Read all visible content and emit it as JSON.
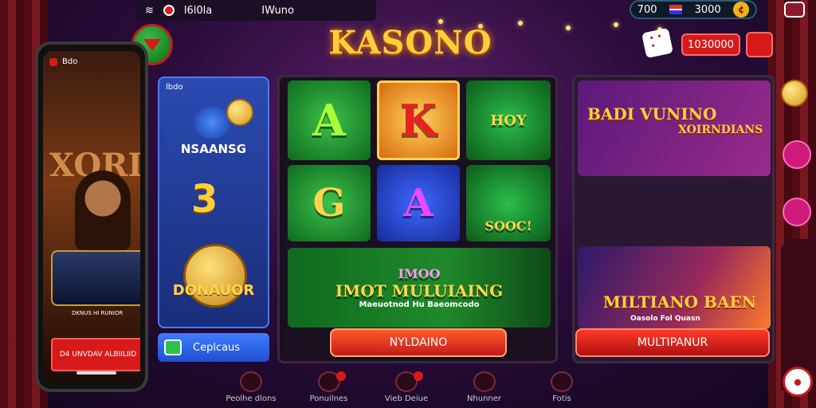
{
  "statusbar": {
    "left_text": "l6l0la",
    "right_text": "IWuno"
  },
  "brand": {
    "title": "KASONO"
  },
  "wallet": {
    "amount_left": "700",
    "amount_right": "3000",
    "coin_icon": "coin-icon"
  },
  "balance_button": {
    "label": "1030000"
  },
  "phone": {
    "header": "Bdo",
    "bg_text": "XORI",
    "slot_label": "DKNUS HI RUNIOR",
    "cta": "D4 UNVDAV ALBIILIID"
  },
  "left_panel": {
    "tag": "lbdo",
    "title": "NSAANSG",
    "number": "3",
    "badge_label": "DONAUOR",
    "button_label": "Ceplcaus"
  },
  "center_panel": {
    "tiles": {
      "a": "A",
      "k": "K",
      "hoy": "HOY",
      "g": "G",
      "a2": "A",
      "sooc": "SOOC!",
      "banner_title": "IMOT MULUIAING",
      "banner_badge": "IMOO",
      "banner_sub": "Maeuotnod  Hu  Baeomcodo"
    },
    "cta": "NYLDAINO"
  },
  "right_panel": {
    "tile1_title": "BADI VUNINO",
    "tile1_sub": "XOIRNDIANS",
    "tile2_title": "MILTIANO BAEN",
    "tile2_sub": "Oasolo  Fol  Quasn",
    "cta": "MULTIPANUR"
  },
  "bottom_nav": [
    {
      "label": "Peolhe dlons",
      "icon": "home-icon",
      "badge": false
    },
    {
      "label": "Ponuilnes",
      "icon": "heart-icon",
      "badge": true
    },
    {
      "label": "Vieb Deiue",
      "icon": "heart-icon",
      "badge": true
    },
    {
      "label": "Nhunner",
      "icon": "heart-icon",
      "badge": false
    },
    {
      "label": "Fotis",
      "icon": "heart-icon",
      "badge": false
    }
  ],
  "colors": {
    "accent": "#d61a1a",
    "gold": "#ffcf3a",
    "blue": "#2a4ab0",
    "green": "#1f8a2a"
  }
}
